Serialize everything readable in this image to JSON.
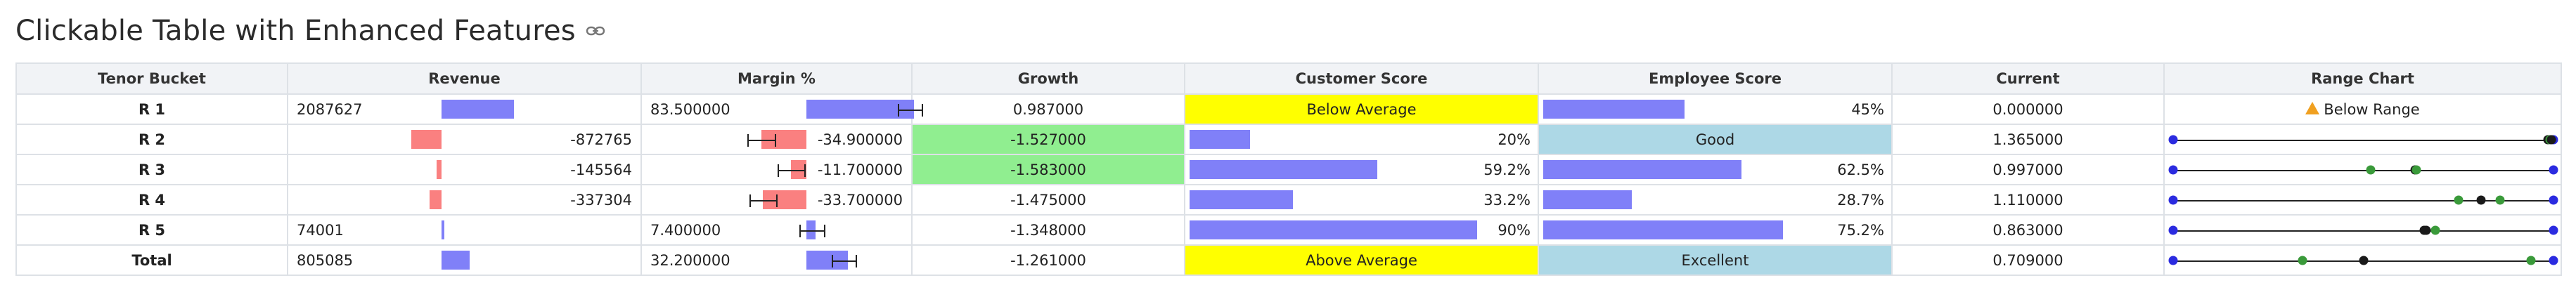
{
  "page": {
    "title": "Clickable Table with Enhanced Features",
    "link_icon": "link-icon"
  },
  "columns": [
    "Tenor Bucket",
    "Revenue",
    "Margin %",
    "Growth",
    "Customer Score",
    "Employee Score",
    "Current",
    "Range Chart"
  ],
  "rows": [
    {
      "bucket": "R 1",
      "revenue": {
        "text": "2087627",
        "value": 2087627
      },
      "margin": {
        "text": "83.500000",
        "value": 83.5
      },
      "growth": {
        "text": "0.987000",
        "highlight": ""
      },
      "customer": {
        "type": "label",
        "text": "Below Average",
        "color": "#ffff00"
      },
      "employee": {
        "type": "bar",
        "text": "45%",
        "value": 0.45
      },
      "current": "0.000000",
      "range": {
        "type": "warning",
        "text": "Below Range",
        "icon": "warning-icon"
      }
    },
    {
      "bucket": "R 2",
      "revenue": {
        "text": "-872765",
        "value": -872765
      },
      "margin": {
        "text": "-34.900000",
        "value": -34.9
      },
      "growth": {
        "text": "-1.527000",
        "highlight": "#90ee90"
      },
      "customer": {
        "type": "bar",
        "text": "20%",
        "value": 0.2
      },
      "employee": {
        "type": "label",
        "text": "Good",
        "color": "#add8e6"
      },
      "current": "1.365000",
      "range": {
        "type": "chart",
        "points": [
          {
            "pos": 0.985,
            "color": "black"
          },
          {
            "pos": 0.99,
            "color": "green"
          },
          {
            "pos": 0.995,
            "color": "black"
          }
        ]
      }
    },
    {
      "bucket": "R 3",
      "revenue": {
        "text": "-145564",
        "value": -145564
      },
      "margin": {
        "text": "-11.700000",
        "value": -11.7
      },
      "growth": {
        "text": "-1.583000",
        "highlight": "#90ee90"
      },
      "customer": {
        "type": "bar",
        "text": "59.2%",
        "value": 0.592
      },
      "employee": {
        "type": "bar",
        "text": "62.5%",
        "value": 0.625
      },
      "current": "0.997000",
      "range": {
        "type": "chart",
        "points": [
          {
            "pos": 0.52,
            "color": "green"
          },
          {
            "pos": 0.635,
            "color": "black"
          },
          {
            "pos": 0.64,
            "color": "green"
          }
        ]
      }
    },
    {
      "bucket": "R 4",
      "revenue": {
        "text": "-337304",
        "value": -337304
      },
      "margin": {
        "text": "-33.700000",
        "value": -33.7
      },
      "growth": {
        "text": "-1.475000",
        "highlight": ""
      },
      "customer": {
        "type": "bar",
        "text": "33.2%",
        "value": 0.332
      },
      "employee": {
        "type": "bar",
        "text": "28.7%",
        "value": 0.287
      },
      "current": "1.110000",
      "range": {
        "type": "chart",
        "points": [
          {
            "pos": 0.75,
            "color": "green"
          },
          {
            "pos": 0.81,
            "color": "black"
          },
          {
            "pos": 0.86,
            "color": "green"
          }
        ]
      }
    },
    {
      "bucket": "R 5",
      "revenue": {
        "text": "74001",
        "value": 74001
      },
      "margin": {
        "text": "7.400000",
        "value": 7.4
      },
      "growth": {
        "text": "-1.348000",
        "highlight": ""
      },
      "customer": {
        "type": "bar",
        "text": "90%",
        "value": 0.9
      },
      "employee": {
        "type": "bar",
        "text": "75.2%",
        "value": 0.752
      },
      "current": "0.863000",
      "range": {
        "type": "chart",
        "points": [
          {
            "pos": 0.66,
            "color": "black"
          },
          {
            "pos": 0.665,
            "color": "black"
          },
          {
            "pos": 0.69,
            "color": "green"
          }
        ]
      }
    },
    {
      "bucket": "Total",
      "revenue": {
        "text": "805085",
        "value": 805085
      },
      "margin": {
        "text": "32.200000",
        "value": 32.2
      },
      "growth": {
        "text": "-1.261000",
        "highlight": ""
      },
      "customer": {
        "type": "label",
        "text": "Above Average",
        "color": "#ffff00"
      },
      "employee": {
        "type": "label",
        "text": "Excellent",
        "color": "#add8e6"
      },
      "current": "0.709000",
      "range": {
        "type": "chart",
        "points": [
          {
            "pos": 0.34,
            "color": "green"
          },
          {
            "pos": 0.5,
            "color": "black"
          },
          {
            "pos": 0.94,
            "color": "green"
          }
        ]
      }
    }
  ],
  "colors": {
    "positive_bar": "#8080f8",
    "negative_bar": "#fa8080",
    "highlight_yellow": "#ffff00",
    "highlight_blue": "#add8e6",
    "highlight_green": "#90ee90",
    "range_endpoint": "#2b2be0"
  }
}
